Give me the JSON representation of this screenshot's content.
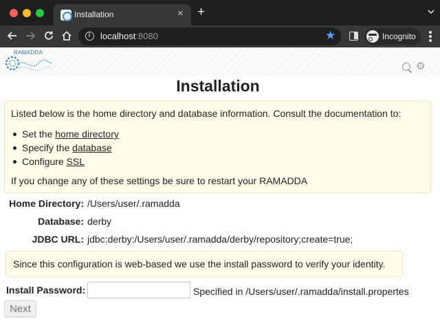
{
  "browser": {
    "tab_title": "Installation",
    "url_host": "localhost",
    "url_port": ":8080",
    "profile_label": "Incognito",
    "icons": {
      "back": "arrow-left-icon",
      "forward": "arrow-right-icon",
      "reload": "reload-icon",
      "home": "home-icon",
      "bookmark": "star-icon",
      "accent_color": "#5a9cf8"
    }
  },
  "site": {
    "logo_text": "RAMADDA"
  },
  "page": {
    "title": "Installation",
    "notice": {
      "intro": "Listed below is the home directory and database information. Consult the documentation to:",
      "items": [
        {
          "prefix": "Set the ",
          "link": "home directory"
        },
        {
          "prefix": "Specify the ",
          "link": "database"
        },
        {
          "prefix": "Configure ",
          "link": "SSL"
        }
      ],
      "footer": "If you change any of these settings be sure to restart your RAMADDA"
    },
    "info": [
      {
        "label": "Home Directory:",
        "value": "/Users/user/.ramadda"
      },
      {
        "label": "Database:",
        "value": "derby"
      },
      {
        "label": "JDBC URL:",
        "value": "jdbc:derby:/Users/user/.ramadda/derby/repository;create=true;"
      }
    ],
    "password_notice": "Since this configuration is web-based we use the install password to verify your identity.",
    "password_label": "Install Password:",
    "password_value": "",
    "password_hint": "Specified in /Users/user/.ramadda/install.propertes",
    "next_label": "Next",
    "notice_bg": "#fffde9"
  }
}
